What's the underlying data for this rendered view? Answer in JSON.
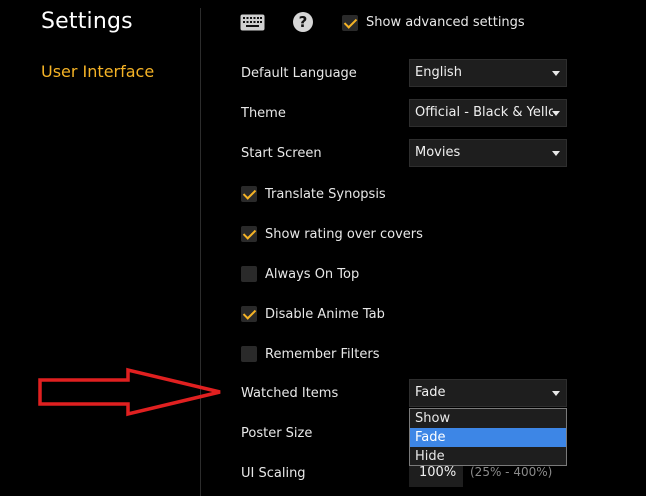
{
  "sidebar": {
    "title": "Settings",
    "items": [
      {
        "label": "User Interface",
        "color": "#f5b326"
      }
    ]
  },
  "topbar": {
    "keyboard_icon": "keyboard-icon",
    "help_icon": "help-icon",
    "help_glyph": "?",
    "show_advanced": {
      "label": "Show advanced settings",
      "checked": true
    }
  },
  "settings": {
    "default_language": {
      "label": "Default Language",
      "value": "English"
    },
    "theme": {
      "label": "Theme",
      "value": "Official - Black & Yellow"
    },
    "start_screen": {
      "label": "Start Screen",
      "value": "Movies"
    },
    "checkboxes": [
      {
        "label": "Translate Synopsis",
        "checked": true
      },
      {
        "label": "Show rating over covers",
        "checked": true
      },
      {
        "label": "Always On Top",
        "checked": false
      },
      {
        "label": "Disable Anime Tab",
        "checked": true
      },
      {
        "label": "Remember Filters",
        "checked": false
      }
    ],
    "watched_items": {
      "label": "Watched Items",
      "value": "Fade",
      "options": [
        "Show",
        "Fade",
        "Hide"
      ],
      "selected_option": "Fade"
    },
    "poster_size": {
      "label": "Poster Size"
    },
    "ui_scaling": {
      "label": "UI Scaling",
      "value": "100%",
      "range_hint": "(25% - 400%)"
    }
  },
  "annotation": {
    "arrow_color": "#e02020"
  }
}
